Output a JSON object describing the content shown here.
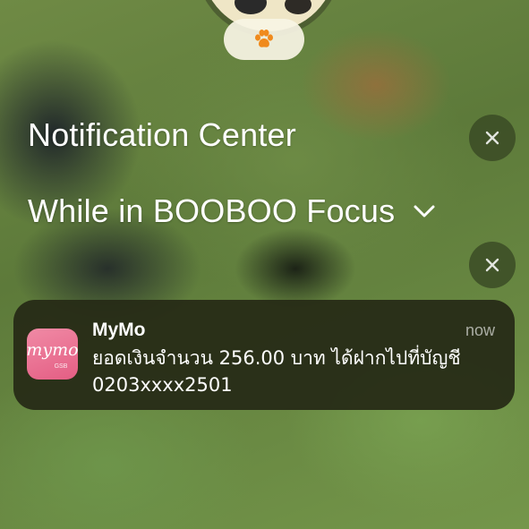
{
  "focus": {
    "icon": "paw-icon",
    "pill_color": "#f8f4e4",
    "icon_color": "#f08a1c"
  },
  "notification_center": {
    "title": "Notification Center",
    "focus_filter_label": "While in BOOBOO Focus"
  },
  "notification": {
    "app_name": "MyMo",
    "app_icon_text": "mymo",
    "app_icon_subtext": "GSB",
    "timestamp": "now",
    "message": "ยอดเงินจำนวน 256.00 บาท ได้ฝากไปที่บัญชี\n0203xxxx2501",
    "background": "#262a16",
    "icon_color": "#e9708f"
  }
}
